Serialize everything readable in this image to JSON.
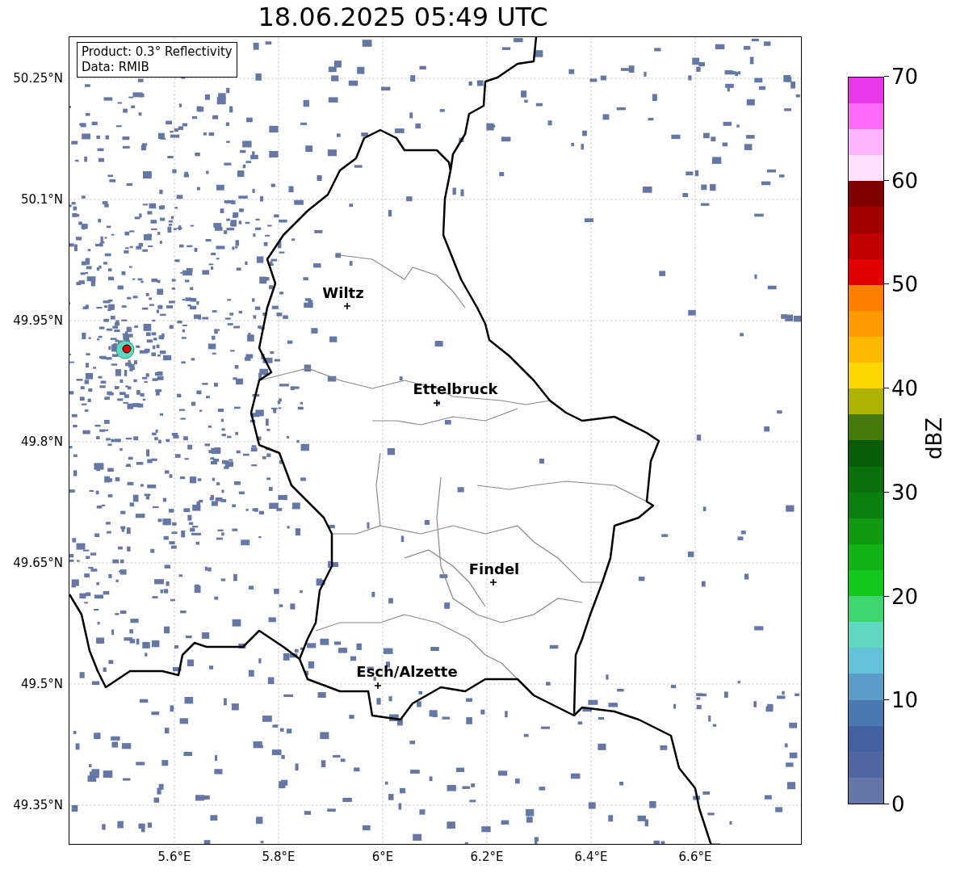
{
  "title": "18.06.2025 05:49 UTC",
  "legend": [
    "Product: 0.3° Reflectivity",
    "Data: RMIB"
  ],
  "y_ticks": [
    "50.25°N",
    "50.1°N",
    "49.95°N",
    "49.8°N",
    "49.65°N",
    "49.5°N",
    "49.35°N"
  ],
  "x_ticks": [
    "5.6°E",
    "5.8°E",
    "6°E",
    "6.2°E",
    "6.4°E",
    "6.6°E"
  ],
  "cities": [
    "Wiltz",
    "Ettelbruck",
    "Findel",
    "Esch/Alzette"
  ],
  "colorbar": {
    "label": "dBZ",
    "ticks": [
      "70",
      "60",
      "50",
      "40",
      "30",
      "20",
      "10",
      "0"
    ],
    "levels": [
      {
        "color": "#6577a6"
      },
      {
        "color": "#5266a0"
      },
      {
        "color": "#4561a3"
      },
      {
        "color": "#4a78b0"
      },
      {
        "color": "#5a9cc6"
      },
      {
        "color": "#63c1d8"
      },
      {
        "color": "#5fd8c0"
      },
      {
        "color": "#3ed66e"
      },
      {
        "color": "#12c81c"
      },
      {
        "color": "#10b414"
      },
      {
        "color": "#0f9a12"
      },
      {
        "color": "#0b800f"
      },
      {
        "color": "#0a700c"
      },
      {
        "color": "#085c0a"
      },
      {
        "color": "#457a0b"
      },
      {
        "color": "#adb200"
      },
      {
        "color": "#ffd600"
      },
      {
        "color": "#ffb900"
      },
      {
        "color": "#ff9a00"
      },
      {
        "color": "#ff7f00"
      },
      {
        "color": "#e00000"
      },
      {
        "color": "#c00000"
      },
      {
        "color": "#a00000"
      },
      {
        "color": "#7e0000"
      },
      {
        "color": "#ffe1ff"
      },
      {
        "color": "#ffb4ff"
      },
      {
        "color": "#ff6af7"
      },
      {
        "color": "#e838e8"
      }
    ]
  }
}
